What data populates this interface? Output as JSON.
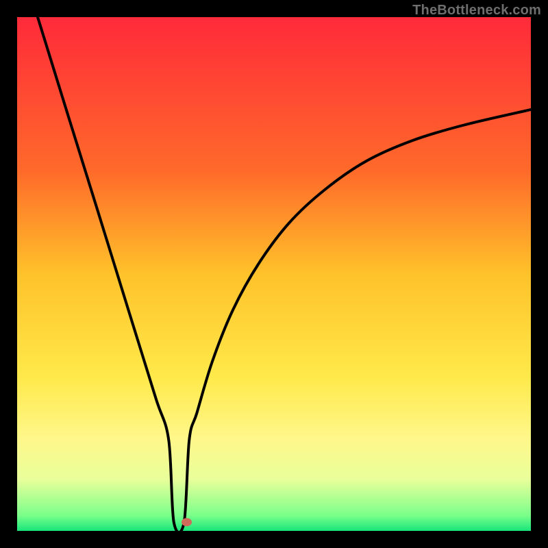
{
  "watermark": "TheBottleneck.com",
  "chart_data": {
    "type": "line",
    "title": "",
    "xlabel": "",
    "ylabel": "",
    "xlim": [
      0,
      100
    ],
    "ylim": [
      0,
      100
    ],
    "gradient_stops": [
      {
        "offset": 0,
        "color": "#ff2a3a"
      },
      {
        "offset": 30,
        "color": "#ff6a2a"
      },
      {
        "offset": 50,
        "color": "#ffc22a"
      },
      {
        "offset": 70,
        "color": "#ffe94a"
      },
      {
        "offset": 82,
        "color": "#fff78a"
      },
      {
        "offset": 90,
        "color": "#e8ff9a"
      },
      {
        "offset": 97,
        "color": "#7aff8a"
      },
      {
        "offset": 100,
        "color": "#17e57b"
      }
    ],
    "curve": {
      "comment": "Black V-curve: steep linear descent to a narrow flat trough near x≈31, then a concave-rising curve tapering toward the top-right.",
      "x": [
        4,
        10,
        16,
        22,
        27,
        29.5,
        30.5,
        32.5,
        33.5,
        35,
        38,
        42,
        47,
        53,
        60,
        68,
        77,
        87,
        100
      ],
      "y": [
        100,
        80.6,
        61.3,
        41.9,
        25.8,
        17.7,
        1.7,
        1.7,
        17.7,
        23,
        33,
        43,
        52,
        60,
        66.5,
        72,
        76,
        79,
        82
      ]
    },
    "marker": {
      "x": 33.0,
      "y": 1.7,
      "r": 1.0,
      "color": "#cf6b59"
    }
  }
}
